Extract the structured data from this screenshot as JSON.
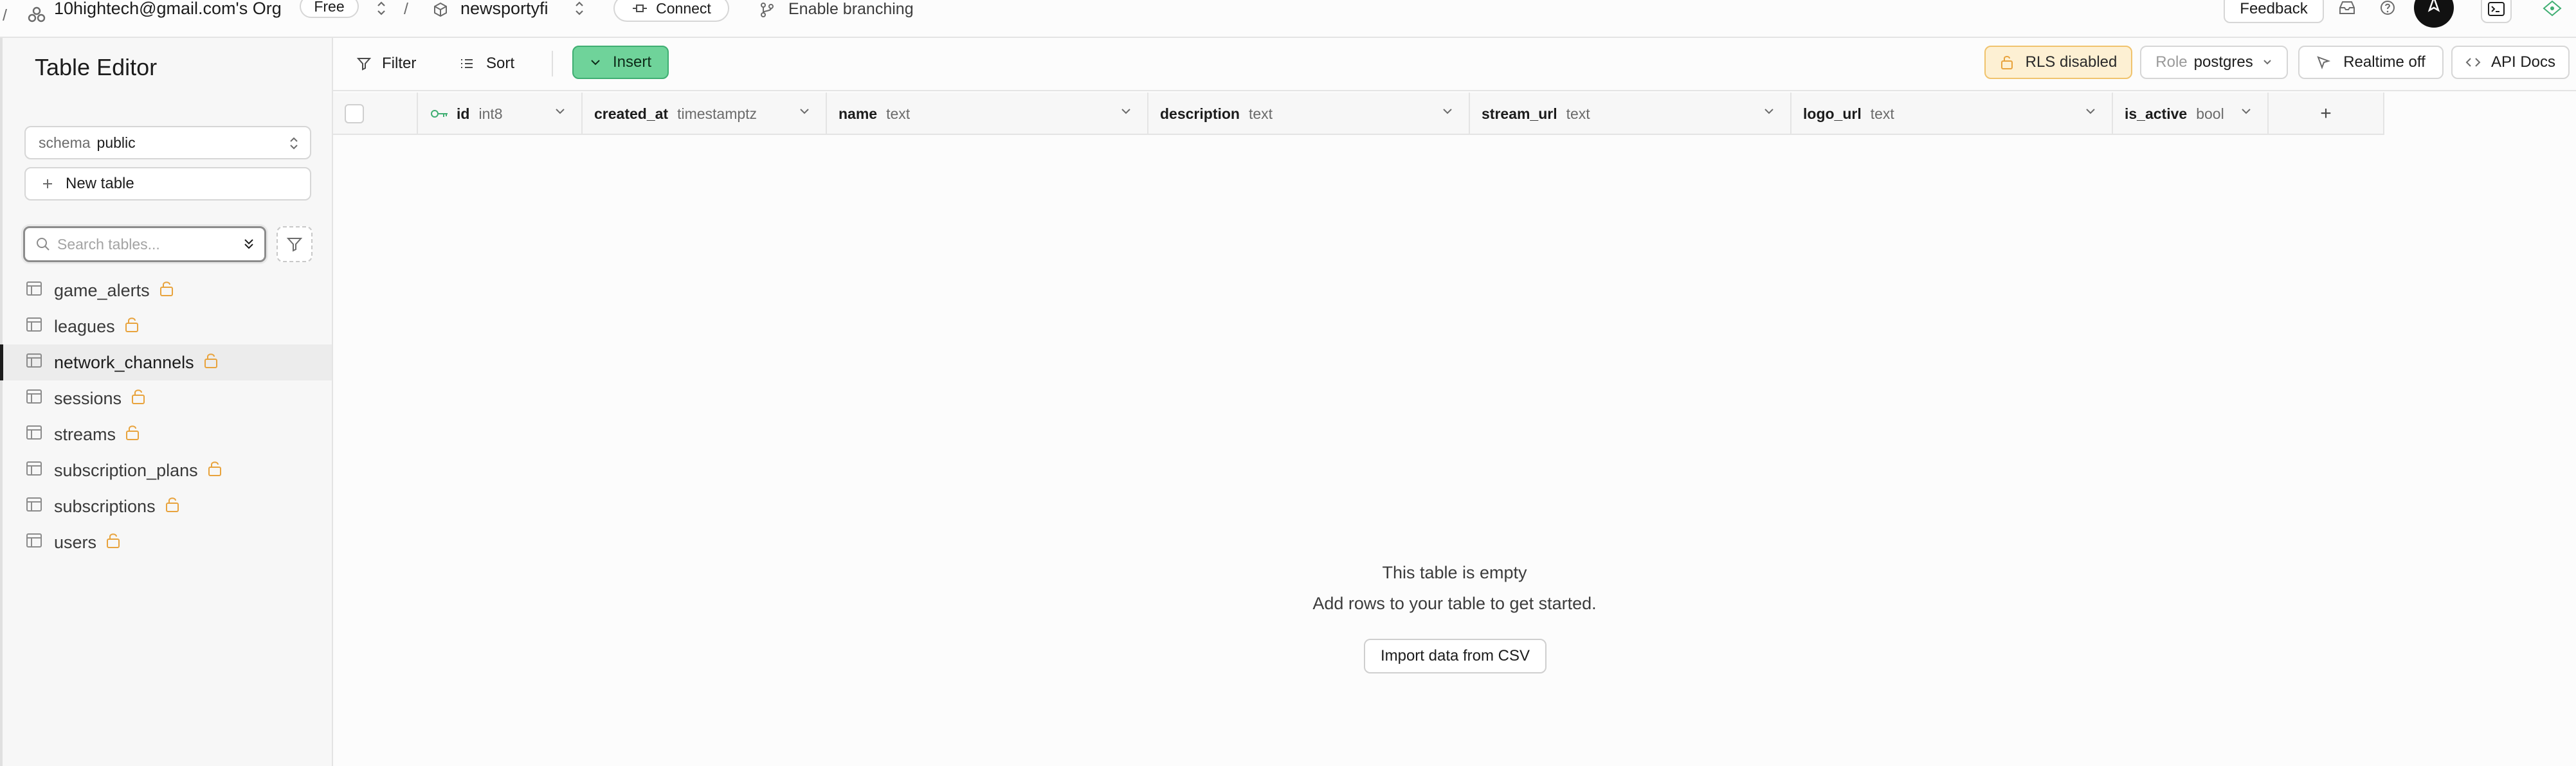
{
  "topbar": {
    "org_name": "10hightech@gmail.com's Org",
    "plan_badge": "Free",
    "separator": "/",
    "project_name": "newsportyfi",
    "connect_label": "Connect",
    "branching_label": "Enable branching",
    "feedback_label": "Feedback"
  },
  "sidebar": {
    "title": "Table Editor",
    "schema_prefix": "schema",
    "schema_value": "public",
    "new_table_label": "New table",
    "search_placeholder": "Search tables...",
    "tables": [
      {
        "name": "game_alerts",
        "active": false
      },
      {
        "name": "leagues",
        "active": false
      },
      {
        "name": "network_channels",
        "active": true
      },
      {
        "name": "sessions",
        "active": false
      },
      {
        "name": "streams",
        "active": false
      },
      {
        "name": "subscription_plans",
        "active": false
      },
      {
        "name": "subscriptions",
        "active": false
      },
      {
        "name": "users",
        "active": false
      }
    ]
  },
  "toolbar": {
    "filter_label": "Filter",
    "sort_label": "Sort",
    "insert_label": "Insert",
    "rls_label": "RLS disabled",
    "role_prefix": "Role",
    "role_value": "postgres",
    "realtime_label": "Realtime off",
    "api_docs_label": "API Docs"
  },
  "grid": {
    "columns": [
      {
        "name": "id",
        "type": "int8",
        "primary_key": true
      },
      {
        "name": "created_at",
        "type": "timestamptz"
      },
      {
        "name": "name",
        "type": "text"
      },
      {
        "name": "description",
        "type": "text"
      },
      {
        "name": "stream_url",
        "type": "text"
      },
      {
        "name": "logo_url",
        "type": "text"
      },
      {
        "name": "is_active",
        "type": "bool"
      }
    ],
    "add_column_symbol": "+"
  },
  "empty_state": {
    "title": "This table is empty",
    "subtitle": "Add rows to your table to get started.",
    "import_label": "Import data from CSV"
  },
  "colors": {
    "insert_green": "#6fd39a",
    "rls_amber": "#fdf0d3",
    "lock_orange": "#e8a33d",
    "key_green": "#3fae72"
  }
}
